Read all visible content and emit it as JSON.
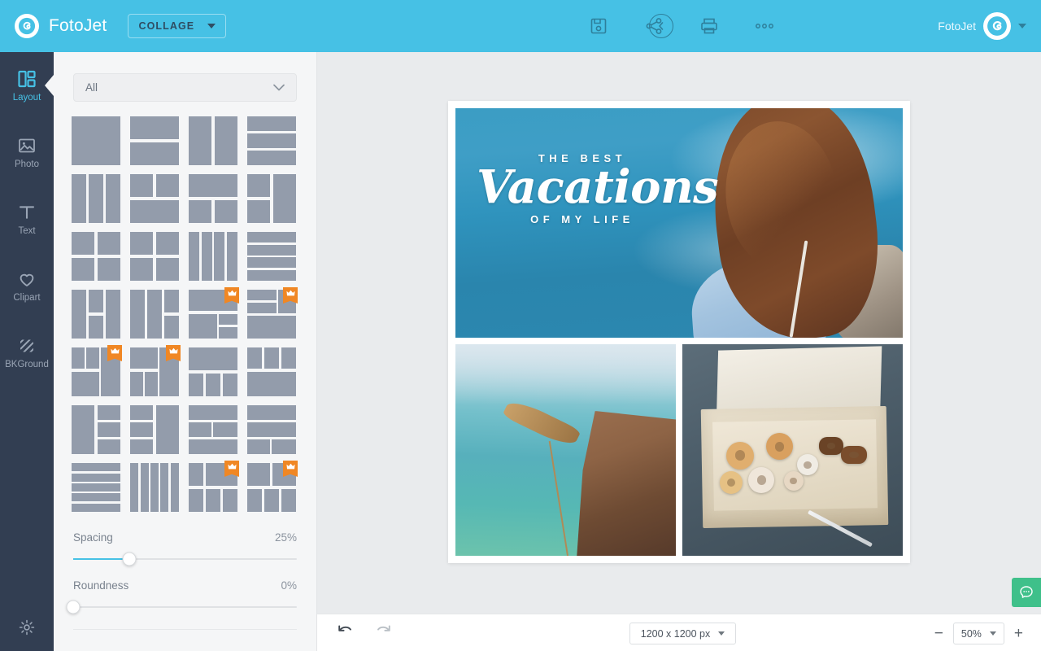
{
  "header": {
    "brand_name": "FotoJet",
    "brand_logo_icon": "fotojet-spiral-icon",
    "mode_label": "COLLAGE",
    "back_icon": "chevron-left-circle-icon",
    "tools": [
      {
        "name": "save-icon",
        "title": "Save"
      },
      {
        "name": "share-icon",
        "title": "Share"
      },
      {
        "name": "print-icon",
        "title": "Print"
      },
      {
        "name": "more-options-icon",
        "title": "More"
      }
    ],
    "account_name": "FotoJet",
    "account_avatar_icon": "fotojet-spiral-icon",
    "account_caret_icon": "caret-down-icon",
    "bg_color": "#46c1e5"
  },
  "sidebar": {
    "items": [
      {
        "label": "Layout",
        "icon": "layout-grid-icon",
        "active": true
      },
      {
        "label": "Photo",
        "icon": "image-icon",
        "active": false
      },
      {
        "label": "Text",
        "icon": "text-t-icon",
        "active": false
      },
      {
        "label": "Clipart",
        "icon": "heart-icon",
        "active": false
      },
      {
        "label": "BKGround",
        "icon": "hatch-pattern-icon",
        "active": false
      }
    ],
    "settings_icon": "gear-icon",
    "active_color": "#46c1e5",
    "bg_color": "#323e52"
  },
  "panel": {
    "filter_label": "All",
    "filter_caret_icon": "chevron-down-icon",
    "crown_icon": "crown-premium-icon",
    "templates": [
      {
        "id": "t1",
        "premium": false,
        "cells": [
          [
            0,
            0,
            100,
            100
          ]
        ]
      },
      {
        "id": "t2",
        "premium": false,
        "cells": [
          [
            0,
            0,
            100,
            46
          ],
          [
            0,
            54,
            100,
            46
          ]
        ]
      },
      {
        "id": "t3",
        "premium": false,
        "cells": [
          [
            0,
            0,
            46,
            100
          ],
          [
            54,
            0,
            46,
            100
          ]
        ]
      },
      {
        "id": "t4",
        "premium": false,
        "cells": [
          [
            0,
            0,
            100,
            30
          ],
          [
            0,
            35,
            100,
            30
          ],
          [
            0,
            70,
            100,
            30
          ]
        ]
      },
      {
        "id": "t5",
        "premium": false,
        "cells": [
          [
            0,
            0,
            30,
            100
          ],
          [
            35,
            0,
            30,
            100
          ],
          [
            70,
            0,
            30,
            100
          ]
        ]
      },
      {
        "id": "t6",
        "premium": false,
        "cells": [
          [
            0,
            0,
            46,
            46
          ],
          [
            54,
            0,
            46,
            46
          ],
          [
            0,
            54,
            100,
            46
          ]
        ]
      },
      {
        "id": "t7",
        "premium": false,
        "cells": [
          [
            0,
            0,
            100,
            46
          ],
          [
            0,
            54,
            46,
            46
          ],
          [
            54,
            54,
            46,
            46
          ]
        ]
      },
      {
        "id": "t8",
        "premium": false,
        "cells": [
          [
            0,
            0,
            46,
            46
          ],
          [
            0,
            54,
            46,
            46
          ],
          [
            54,
            0,
            46,
            100
          ]
        ]
      },
      {
        "id": "t9",
        "premium": false,
        "cells": [
          [
            0,
            0,
            46,
            46
          ],
          [
            54,
            0,
            46,
            46
          ],
          [
            0,
            54,
            46,
            46
          ],
          [
            54,
            54,
            46,
            46
          ]
        ]
      },
      {
        "id": "t10",
        "premium": false,
        "cells": [
          [
            0,
            0,
            46,
            46
          ],
          [
            54,
            0,
            46,
            46
          ],
          [
            0,
            54,
            46,
            46
          ],
          [
            54,
            54,
            46,
            46
          ]
        ]
      },
      {
        "id": "t11",
        "premium": false,
        "cells": [
          [
            0,
            0,
            22,
            100
          ],
          [
            26,
            0,
            22,
            100
          ],
          [
            52,
            0,
            22,
            100
          ],
          [
            78,
            0,
            22,
            100
          ]
        ]
      },
      {
        "id": "t12",
        "premium": false,
        "cells": [
          [
            0,
            0,
            100,
            22
          ],
          [
            0,
            26,
            100,
            22
          ],
          [
            0,
            52,
            100,
            22
          ],
          [
            0,
            78,
            100,
            22
          ]
        ]
      },
      {
        "id": "t13",
        "premium": false,
        "cells": [
          [
            0,
            0,
            30,
            100
          ],
          [
            35,
            0,
            30,
            46
          ],
          [
            35,
            54,
            30,
            46
          ],
          [
            70,
            0,
            30,
            100
          ]
        ]
      },
      {
        "id": "t14",
        "premium": false,
        "cells": [
          [
            0,
            0,
            30,
            100
          ],
          [
            35,
            0,
            30,
            100
          ],
          [
            70,
            0,
            30,
            46
          ],
          [
            70,
            54,
            30,
            46
          ]
        ]
      },
      {
        "id": "t15",
        "premium": true,
        "cells": [
          [
            0,
            0,
            100,
            44
          ],
          [
            0,
            50,
            58,
            50
          ],
          [
            62,
            50,
            38,
            22
          ],
          [
            62,
            76,
            38,
            24
          ]
        ]
      },
      {
        "id": "t16",
        "premium": true,
        "cells": [
          [
            0,
            0,
            60,
            22
          ],
          [
            0,
            26,
            60,
            22
          ],
          [
            64,
            0,
            36,
            48
          ],
          [
            0,
            54,
            100,
            46
          ]
        ]
      },
      {
        "id": "t17",
        "premium": true,
        "cells": [
          [
            0,
            0,
            26,
            44
          ],
          [
            30,
            0,
            26,
            44
          ],
          [
            60,
            0,
            40,
            100
          ],
          [
            0,
            50,
            56,
            50
          ]
        ]
      },
      {
        "id": "t18",
        "premium": true,
        "cells": [
          [
            0,
            0,
            56,
            44
          ],
          [
            60,
            0,
            40,
            100
          ],
          [
            0,
            50,
            26,
            50
          ],
          [
            30,
            50,
            26,
            50
          ]
        ]
      },
      {
        "id": "t19",
        "premium": false,
        "cells": [
          [
            0,
            0,
            100,
            46
          ],
          [
            0,
            54,
            30,
            46
          ],
          [
            35,
            54,
            30,
            46
          ],
          [
            70,
            54,
            30,
            46
          ]
        ]
      },
      {
        "id": "t20",
        "premium": false,
        "cells": [
          [
            0,
            0,
            30,
            44
          ],
          [
            35,
            0,
            30,
            44
          ],
          [
            70,
            0,
            30,
            44
          ],
          [
            0,
            50,
            100,
            50
          ]
        ]
      },
      {
        "id": "t21",
        "premium": false,
        "cells": [
          [
            0,
            0,
            46,
            100
          ],
          [
            54,
            0,
            46,
            30
          ],
          [
            54,
            35,
            46,
            30
          ],
          [
            54,
            70,
            46,
            30
          ]
        ]
      },
      {
        "id": "t22",
        "premium": false,
        "cells": [
          [
            0,
            0,
            46,
            30
          ],
          [
            0,
            35,
            46,
            30
          ],
          [
            0,
            70,
            46,
            30
          ],
          [
            54,
            0,
            46,
            100
          ]
        ]
      },
      {
        "id": "t23",
        "premium": false,
        "cells": [
          [
            0,
            0,
            100,
            30
          ],
          [
            0,
            35,
            46,
            30
          ],
          [
            50,
            35,
            50,
            30
          ],
          [
            0,
            70,
            100,
            30
          ]
        ]
      },
      {
        "id": "t24",
        "premium": false,
        "cells": [
          [
            0,
            0,
            100,
            30
          ],
          [
            0,
            35,
            100,
            30
          ],
          [
            0,
            70,
            46,
            30
          ],
          [
            50,
            70,
            50,
            30
          ]
        ]
      },
      {
        "id": "t25",
        "premium": false,
        "cells": [
          [
            0,
            0,
            100,
            17
          ],
          [
            0,
            21,
            100,
            17
          ],
          [
            0,
            42,
            100,
            17
          ],
          [
            0,
            62,
            100,
            17
          ],
          [
            0,
            83,
            100,
            17
          ]
        ]
      },
      {
        "id": "t26",
        "premium": false,
        "cells": [
          [
            0,
            0,
            17,
            100
          ],
          [
            21,
            0,
            17,
            100
          ],
          [
            42,
            0,
            17,
            100
          ],
          [
            62,
            0,
            17,
            100
          ],
          [
            83,
            0,
            17,
            100
          ]
        ]
      },
      {
        "id": "t27",
        "premium": true,
        "cells": [
          [
            0,
            0,
            30,
            46
          ],
          [
            35,
            0,
            65,
            46
          ],
          [
            0,
            54,
            30,
            46
          ],
          [
            35,
            54,
            30,
            46
          ],
          [
            70,
            54,
            30,
            46
          ]
        ]
      },
      {
        "id": "t28",
        "premium": true,
        "cells": [
          [
            0,
            0,
            46,
            46
          ],
          [
            52,
            0,
            48,
            46
          ],
          [
            0,
            54,
            30,
            46
          ],
          [
            35,
            54,
            30,
            46
          ],
          [
            70,
            54,
            30,
            46
          ]
        ]
      }
    ],
    "spacing": {
      "label": "Spacing",
      "value": "25%",
      "percent": 25
    },
    "roundness": {
      "label": "Roundness",
      "value": "0%",
      "percent": 0
    },
    "accent_color": "#46c1e5"
  },
  "canvas": {
    "overlay": {
      "top_text": "THE BEST",
      "script_text": "Vacations",
      "bottom_text": "OF MY LIFE"
    },
    "photos": [
      {
        "name": "photo-sea-woman",
        "description": "Woman with curly hair by sparkling blue sea"
      },
      {
        "name": "photo-cliff-wheat",
        "description": "Turquoise sea, cliff and wheat stalk"
      },
      {
        "name": "photo-donuts-box",
        "description": "Open box of sprinkled donuts on dark table"
      }
    ]
  },
  "bottom_bar": {
    "undo_icon": "undo-arrow-icon",
    "redo_icon": "redo-arrow-icon",
    "size_value": "1200 x 1200 px",
    "size_caret_icon": "caret-down-icon",
    "zoom_out_label": "−",
    "zoom_value": "50%",
    "zoom_caret_icon": "caret-down-icon",
    "zoom_in_label": "+"
  },
  "chat_widget": {
    "icon": "chat-bubble-icon",
    "color": "#3fc08a"
  }
}
